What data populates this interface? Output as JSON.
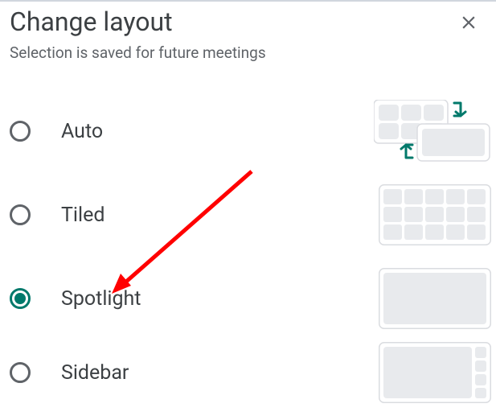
{
  "dialog": {
    "title": "Change layout",
    "subtitle": "Selection is saved for future meetings"
  },
  "options": [
    {
      "id": "auto",
      "label": "Auto",
      "selected": false
    },
    {
      "id": "tiled",
      "label": "Tiled",
      "selected": false
    },
    {
      "id": "spotlight",
      "label": "Spotlight",
      "selected": true
    },
    {
      "id": "sidebar",
      "label": "Sidebar",
      "selected": false
    }
  ],
  "colors": {
    "accent": "#00796b",
    "radio_border": "#5f6368",
    "text_primary": "#3c4043",
    "text_secondary": "#5f6368",
    "thumb_tile": "#e8eaed",
    "thumb_border": "#dadce0",
    "arrow": "#ff0000"
  }
}
